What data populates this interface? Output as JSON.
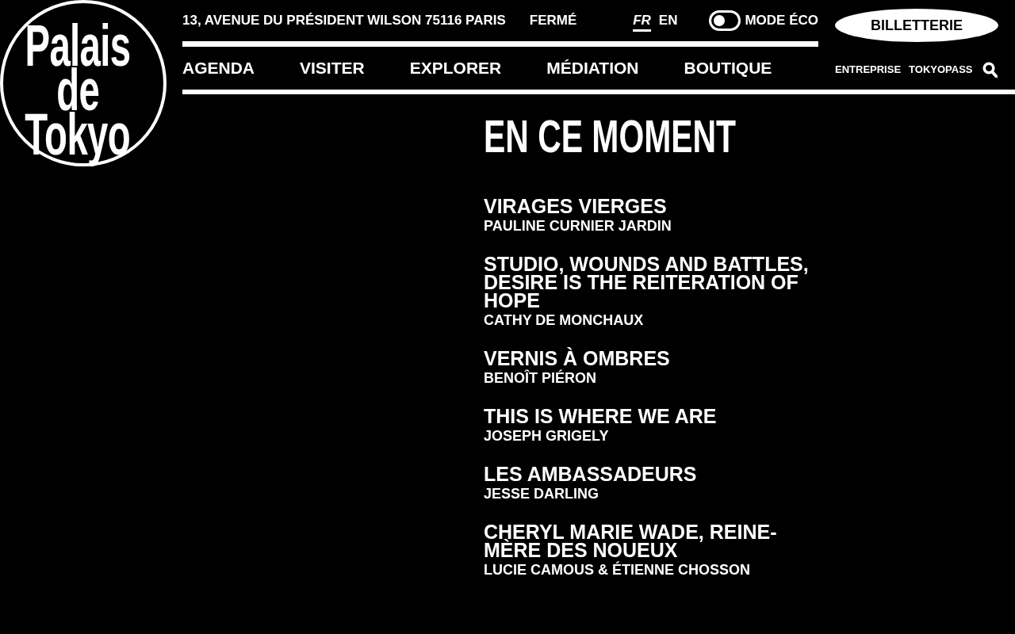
{
  "logo": {
    "lines": [
      "Palais",
      "de",
      "Tokyo"
    ]
  },
  "top_bar": {
    "address": "13, AVENUE DU PRÉSIDENT WILSON 75116 PARIS",
    "opening_status": "FERMÉ",
    "languages": [
      {
        "label": "FR",
        "selected": true
      },
      {
        "label": "EN",
        "selected": false
      }
    ],
    "eco_mode": {
      "label": "MODE ÉCO",
      "on": false
    }
  },
  "ticket_button": "BILLETTERIE",
  "nav": {
    "items": [
      "AGENDA",
      "VISITER",
      "EXPLORER",
      "MÉDIATION",
      "BOUTIQUE"
    ],
    "secondary_links": [
      "ENTREPRISE",
      "TOKYOPASS"
    ]
  },
  "section": {
    "title": "EN CE MOMENT",
    "exhibitions": [
      {
        "title": "VIRAGES VIERGES",
        "artist": "PAULINE CURNIER JARDIN"
      },
      {
        "title": "STUDIO, WOUNDS AND BATTLES, DESIRE IS THE REITERATION OF HOPE",
        "artist": "CATHY DE MONCHAUX"
      },
      {
        "title": "VERNIS À OMBRES",
        "artist": "BENOÎT PIÉRON"
      },
      {
        "title": "THIS IS WHERE WE ARE",
        "artist": "JOSEPH GRIGELY"
      },
      {
        "title": "LES AMBASSADEURS",
        "artist": "JESSE DARLING"
      },
      {
        "title": "CHERYL MARIE WADE, REINE-MÈRE DES NOUEUX",
        "artist": "LUCIE CAMOUS & ÉTIENNE CHOSSON"
      }
    ]
  }
}
